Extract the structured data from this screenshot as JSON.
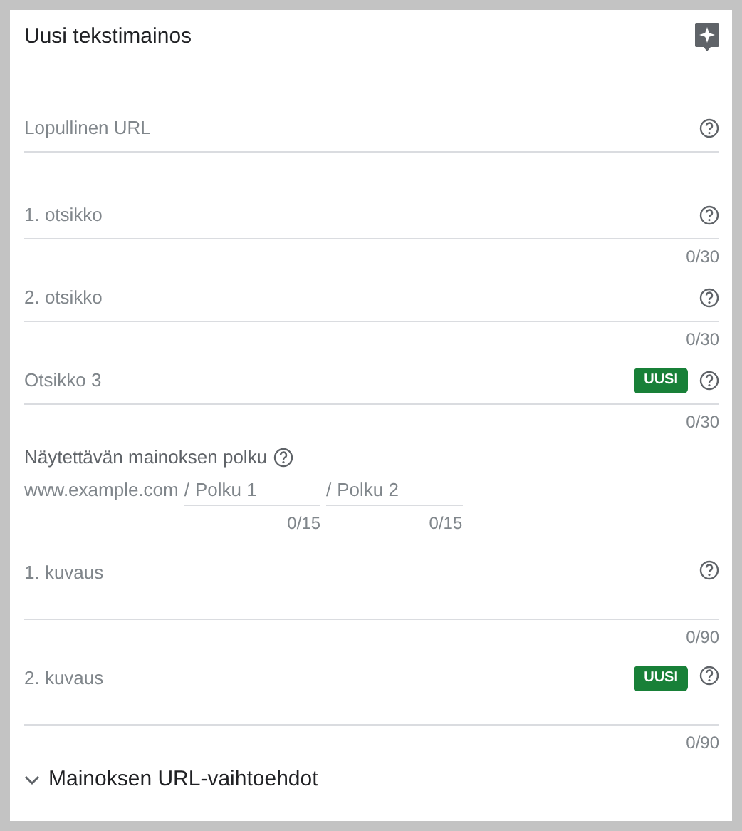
{
  "title": "Uusi tekstimainos",
  "fields": [
    {
      "kind": "text",
      "placeholder": "Lopullinen URL",
      "help": true
    },
    {
      "kind": "text",
      "placeholder": "1. otsikko",
      "help": true,
      "counter": "0/30"
    },
    {
      "kind": "text",
      "placeholder": "2. otsikko",
      "help": true,
      "counter": "0/30"
    },
    {
      "kind": "text",
      "placeholder": "Otsikko 3",
      "badge": "UUSI",
      "help": true,
      "counter": "0/30"
    },
    {
      "kind": "path",
      "label": "Näytettävän mainoksen polku",
      "help": true,
      "domain": "www.example.com",
      "paths": [
        {
          "separator": "/",
          "placeholder": "Polku 1",
          "counter": "0/15"
        },
        {
          "separator": "/",
          "placeholder": "Polku 2",
          "counter": "0/15"
        }
      ]
    },
    {
      "kind": "textarea",
      "placeholder": "1. kuvaus",
      "help": true,
      "counter": "0/90"
    },
    {
      "kind": "textarea",
      "placeholder": "2. kuvaus",
      "badge": "UUSI",
      "help": true,
      "counter": "0/90"
    }
  ],
  "expander": {
    "label": "Mainoksen URL-vaihtoehdot",
    "expanded": false
  }
}
